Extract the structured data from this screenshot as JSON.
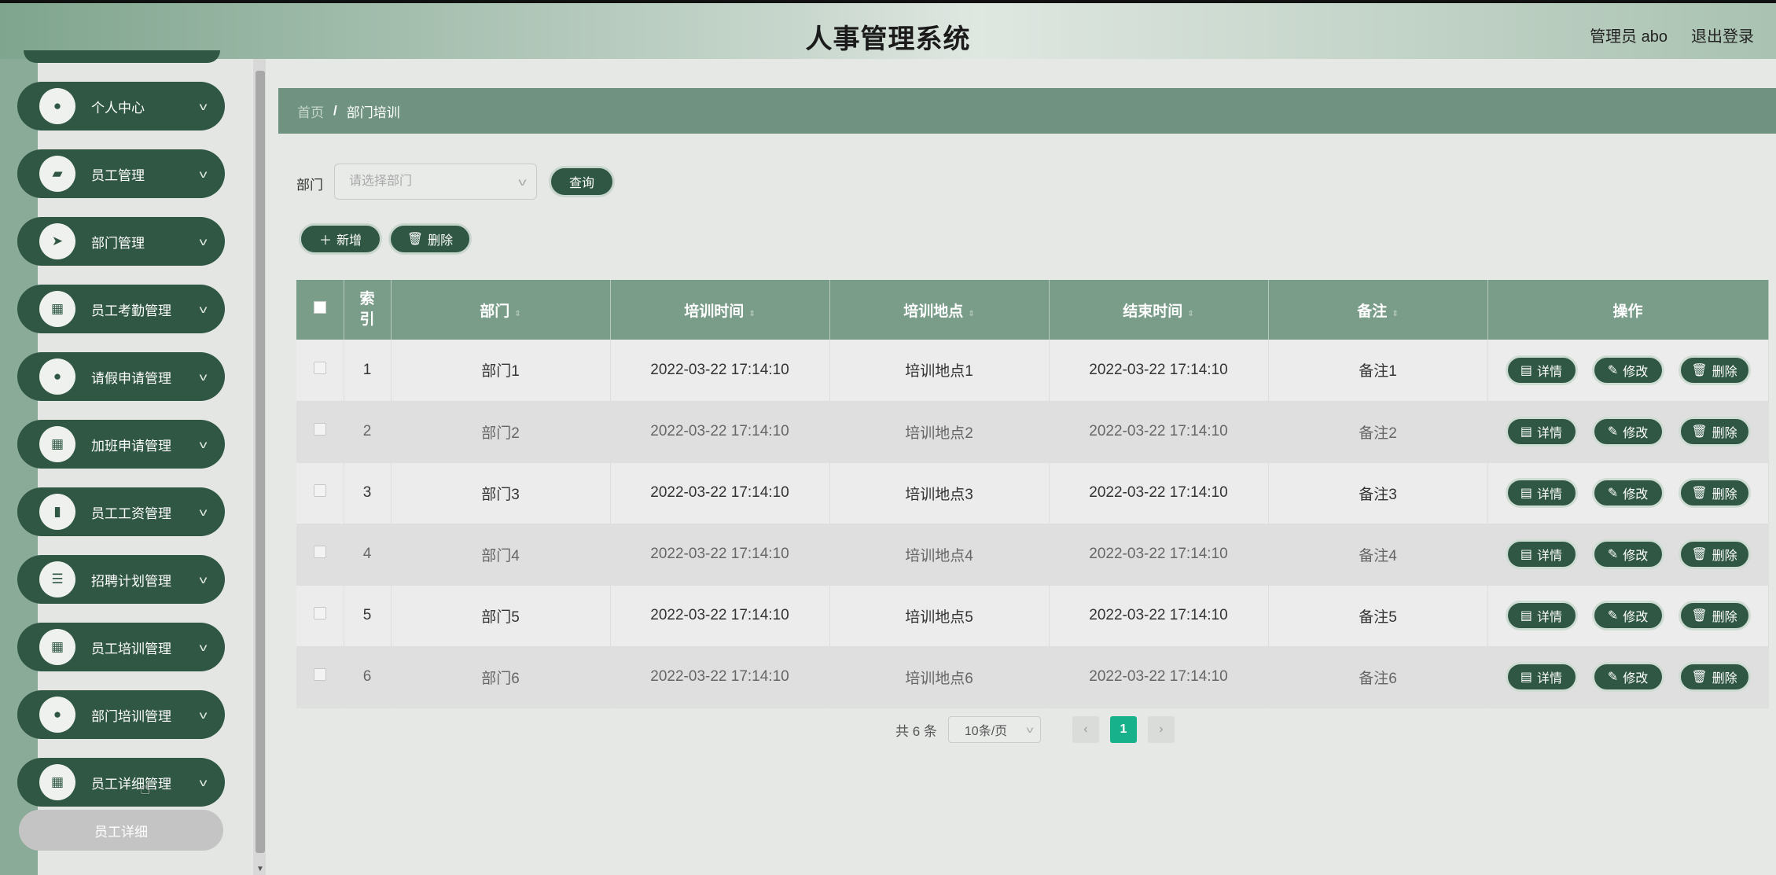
{
  "header": {
    "title": "人事管理系统",
    "user": "管理员 abo",
    "logout": "退出登录"
  },
  "sidebar": {
    "items": [
      {
        "label": "个人中心",
        "icon": "user-icon"
      },
      {
        "label": "员工管理",
        "icon": "briefcase-icon"
      },
      {
        "label": "部门管理",
        "icon": "send-icon"
      },
      {
        "label": "员工考勤管理",
        "icon": "grid-icon"
      },
      {
        "label": "请假申请管理",
        "icon": "user-icon"
      },
      {
        "label": "加班申请管理",
        "icon": "grid-icon"
      },
      {
        "label": "员工工资管理",
        "icon": "bar-chart-icon"
      },
      {
        "label": "招聘计划管理",
        "icon": "list-icon"
      },
      {
        "label": "员工培训管理",
        "icon": "grid-icon"
      },
      {
        "label": "部门培训管理",
        "icon": "user-icon"
      },
      {
        "label": "员工详细管理",
        "icon": "grid-icon"
      }
    ],
    "sub_item": "员工详细"
  },
  "breadcrumb": {
    "home": "首页",
    "separator": "/",
    "current": "部门培训"
  },
  "filter": {
    "label": "部门",
    "placeholder": "请选择部门",
    "query_button": "查询"
  },
  "actions": {
    "add": "新增",
    "delete": "删除"
  },
  "table": {
    "headers": [
      "索引",
      "部门",
      "培训时间",
      "培训地点",
      "结束时间",
      "备注",
      "操作"
    ],
    "rows": [
      {
        "index": "1",
        "dept": "部门1",
        "train_time": "2022-03-22 17:14:10",
        "location": "培训地点1",
        "end_time": "2022-03-22 17:14:10",
        "note": "备注1"
      },
      {
        "index": "2",
        "dept": "部门2",
        "train_time": "2022-03-22 17:14:10",
        "location": "培训地点2",
        "end_time": "2022-03-22 17:14:10",
        "note": "备注2"
      },
      {
        "index": "3",
        "dept": "部门3",
        "train_time": "2022-03-22 17:14:10",
        "location": "培训地点3",
        "end_time": "2022-03-22 17:14:10",
        "note": "备注3"
      },
      {
        "index": "4",
        "dept": "部门4",
        "train_time": "2022-03-22 17:14:10",
        "location": "培训地点4",
        "end_time": "2022-03-22 17:14:10",
        "note": "备注4"
      },
      {
        "index": "5",
        "dept": "部门5",
        "train_time": "2022-03-22 17:14:10",
        "location": "培训地点5",
        "end_time": "2022-03-22 17:14:10",
        "note": "备注5"
      },
      {
        "index": "6",
        "dept": "部门6",
        "train_time": "2022-03-22 17:14:10",
        "location": "培训地点6",
        "end_time": "2022-03-22 17:14:10",
        "note": "备注6"
      }
    ],
    "row_actions": {
      "detail": "详情",
      "edit": "修改",
      "delete": "删除"
    }
  },
  "pagination": {
    "total": "共 6 条",
    "page_size": "10条/页",
    "prev": "‹",
    "current": "1",
    "next": "›"
  },
  "colors": {
    "primary": "#2f5743",
    "header_row": "#7a9d89",
    "breadcrumb": "#6f9380",
    "active_page": "#17b28b"
  }
}
